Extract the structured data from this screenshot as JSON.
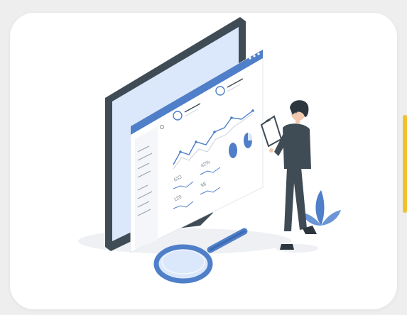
{
  "illustration": {
    "subject": "analytics-dashboard-with-person",
    "colors": {
      "background": "#eeeeef",
      "card": "#ffffff",
      "accent": "#f3c02b",
      "monitor_frame": "#3f4b55",
      "primary_blue": "#4f7fc8",
      "light_blue": "#dbe7fb"
    },
    "screen_values": [
      "633",
      "42%",
      "120",
      "98"
    ],
    "icons": [
      "magnifying-glass-icon",
      "clipboard-icon",
      "plant-icon"
    ]
  }
}
